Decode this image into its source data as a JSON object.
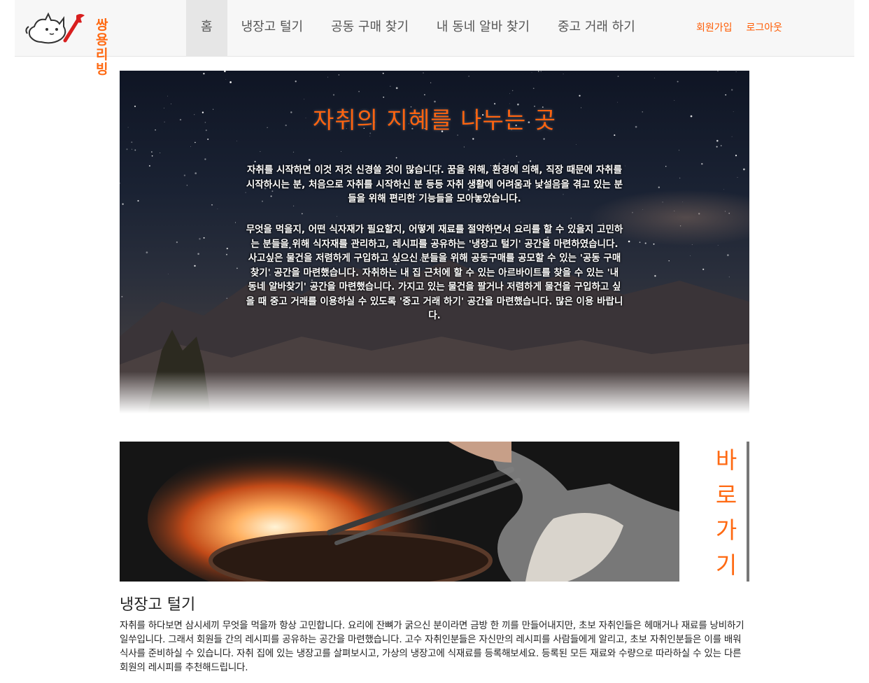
{
  "brand": {
    "logo_text_line1": "쌍용",
    "logo_text_line2": "리빙",
    "accent": "#ff6a13"
  },
  "nav": {
    "items": [
      {
        "label": "홈",
        "active": true
      },
      {
        "label": "냉장고 털기",
        "active": false
      },
      {
        "label": "공동 구매 찾기",
        "active": false
      },
      {
        "label": "내 동네 알바 찾기",
        "active": false
      },
      {
        "label": "중고 거래 하기",
        "active": false
      }
    ]
  },
  "auth": {
    "signup": "회원가입",
    "logout": "로그아웃"
  },
  "hero": {
    "title": "자취의 지혜를 나누는 곳",
    "paragraph1": "자취를 시작하면 이것 저것 신경쓸 것이 많습니다. 꿈을 위해, 환경에 의해, 직장 때문에 자취를 시작하시는 분, 처음으로 자취를 시작하신 분 등등 자취 생활에 어려움과 낯설음을 겪고 있는 분들을 위해 편리한 기능들을 모아놓았습니다.",
    "paragraph2": "무엇을 먹을지, 어떤 식자재가 필요할지, 어떻게 재료를 절약하면서 요리를 할 수 있을지 고민하는 분들을 위해 식자재를 관리하고, 레시피를 공유하는 '냉장고 털기' 공간을 마련하였습니다. 사고싶은 물건을 저렴하게 구입하고 싶으신 분들을 위해 공동구매를 공모할 수 있는 '공동 구매 찾기' 공간을 마련했습니다. 자취하는 내 집 근처에 할 수 있는 아르바이트를 찾을 수 있는 '내 동네 알바찾기' 공간을 마련했습니다. 가지고 있는 물건을 팔거나 저렴하게 물건을 구입하고 싶을 때 중고 거래를 이용하실 수 있도록 '중고 거래 하기' 공간을 마련했습니다. 많은 이용 바랍니다."
  },
  "section": {
    "shortcut_label": "바로가기",
    "title": "냉장고 털기",
    "description": "자취를 하다보면 삼시세끼 무엇을 먹을까 항상 고민합니다. 요리에 잔뼈가 굵으신 분이라면 금방 한 끼를 만들어내지만, 초보 자취인들은 헤매거나 재료를 낭비하기 일쑤입니다. 그래서 회원들 간의 레시피를 공유하는 공간을 마련했습니다. 고수 자취인분들은 자신만의 레시피를 사람들에게 알리고, 초보 자취인분들은 이를 배워 식사를 준비하실 수 있습니다. 자취 집에 있는 냉장고를 살펴보시고, 가상의 냉장고에 식재료를 등록해보세요. 등록된 모든 재료와 수량으로 따라하실 수 있는 다른 회원의 레시피를 추천해드립니다."
  }
}
